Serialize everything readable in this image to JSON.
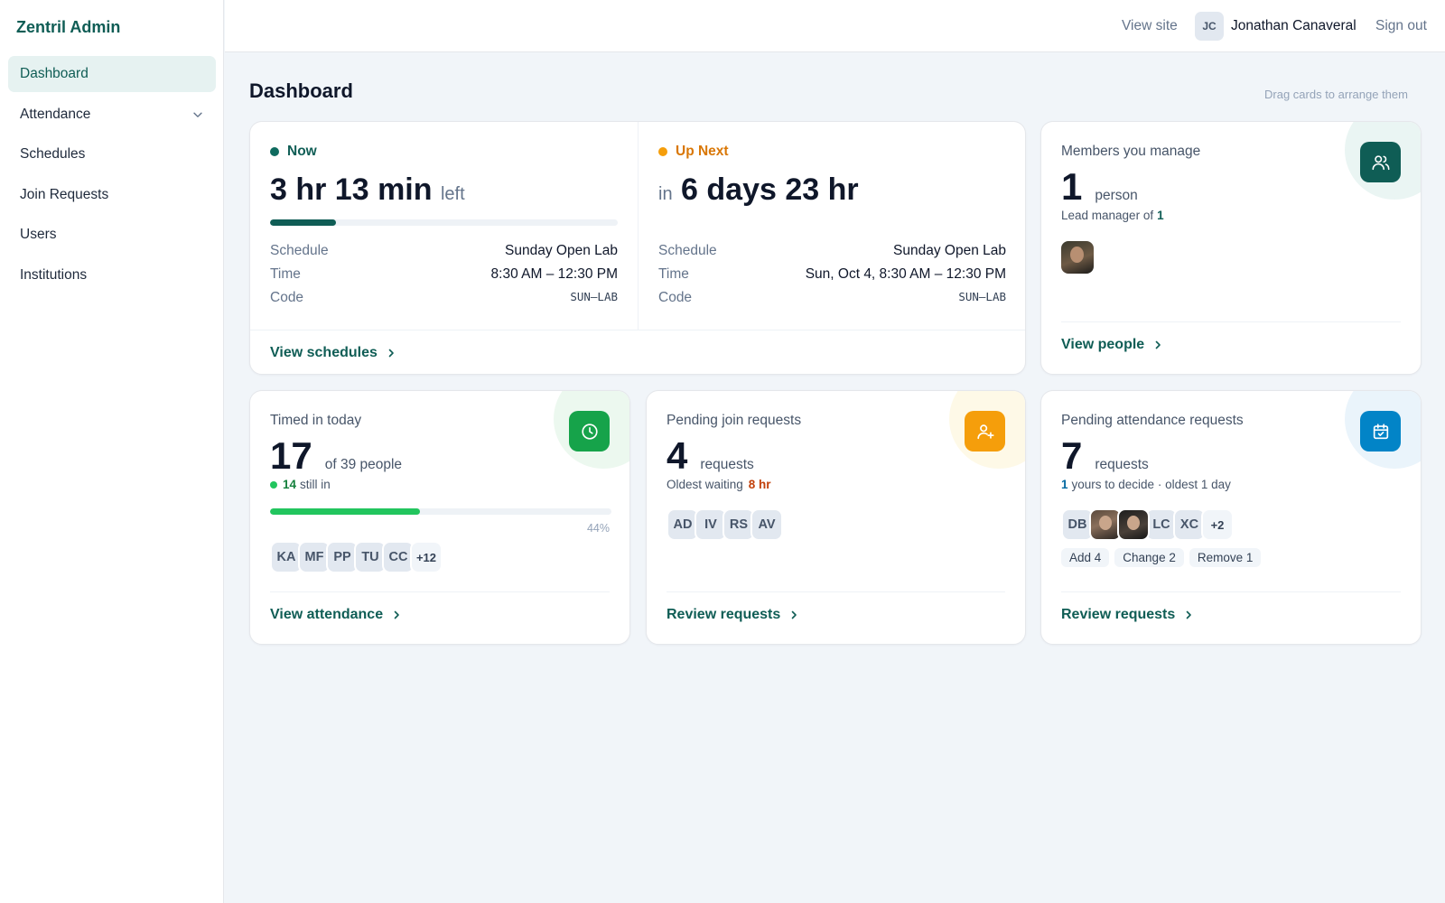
{
  "app": {
    "brand": "Zentril Admin"
  },
  "sidebar": {
    "items": [
      {
        "label": "Dashboard"
      },
      {
        "label": "Attendance"
      },
      {
        "label": "Schedules"
      },
      {
        "label": "Join Requests"
      },
      {
        "label": "Users"
      },
      {
        "label": "Institutions"
      }
    ]
  },
  "topbar": {
    "view_site": "View site",
    "avatar_initials": "JC",
    "username": "Jonathan Canaveral",
    "sign_out": "Sign out"
  },
  "page": {
    "title": "Dashboard",
    "drag_hint": "Drag cards to arrange them"
  },
  "now_card": {
    "now": {
      "status": "Now",
      "time_main": "3 hr 13 min",
      "time_suffix": "left",
      "progress_fraction": 0.19,
      "rows": [
        {
          "key": "Schedule",
          "value": "Sunday Open Lab"
        },
        {
          "key": "Time",
          "value": "8:30 AM – 12:30 PM"
        },
        {
          "key": "Code",
          "value": "SUN–LAB"
        }
      ]
    },
    "next": {
      "status": "Up Next",
      "time_prefix": "in",
      "time_main": "6 days 23 hr",
      "rows": [
        {
          "key": "Schedule",
          "value": "Sunday Open Lab"
        },
        {
          "key": "Time",
          "value": "Sun, Oct 4, 8:30 AM – 12:30 PM"
        },
        {
          "key": "Code",
          "value": "SUN–LAB"
        }
      ]
    },
    "link": "View schedules",
    "colors": {
      "now": "#0f6b5f",
      "next": "#f59e0b"
    }
  },
  "members_card": {
    "label": "Members you manage",
    "count": "1",
    "unit": "person",
    "sub_prefix": "Lead manager of",
    "sub_value": "1",
    "link": "View people",
    "icon": "users-icon",
    "color": "#0f5d55"
  },
  "timed_card": {
    "label": "Timed in today",
    "count": "17",
    "unit": "of 39 people",
    "still_in_value": "14",
    "still_in_text": "still in",
    "progress_fraction": 0.44,
    "progress_label": "44%",
    "chips": [
      "KA",
      "MF",
      "PP",
      "TU",
      "CC",
      "+12"
    ],
    "link": "View attendance",
    "icon": "clock-icon",
    "color": "#16a34a"
  },
  "join_card": {
    "label": "Pending join requests",
    "count": "4",
    "unit": "requests",
    "sub_prefix": "Oldest waiting",
    "sub_value": "8 hr",
    "chips": [
      "AD",
      "IV",
      "RS",
      "AV"
    ],
    "link": "Review requests",
    "icon": "user-plus-icon",
    "color": "#f59e0b"
  },
  "att_card": {
    "label": "Pending attendance requests",
    "count": "7",
    "unit": "requests",
    "sub_value": "1",
    "sub_text": "yours to decide · oldest 1 day",
    "chips_before": [
      "DB"
    ],
    "chips_after": [
      "LC",
      "XC",
      "+2"
    ],
    "pills": [
      "Add 4",
      "Change 2",
      "Remove 1"
    ],
    "link": "Review requests",
    "icon": "calendar-check-icon",
    "color": "#0284c7"
  }
}
